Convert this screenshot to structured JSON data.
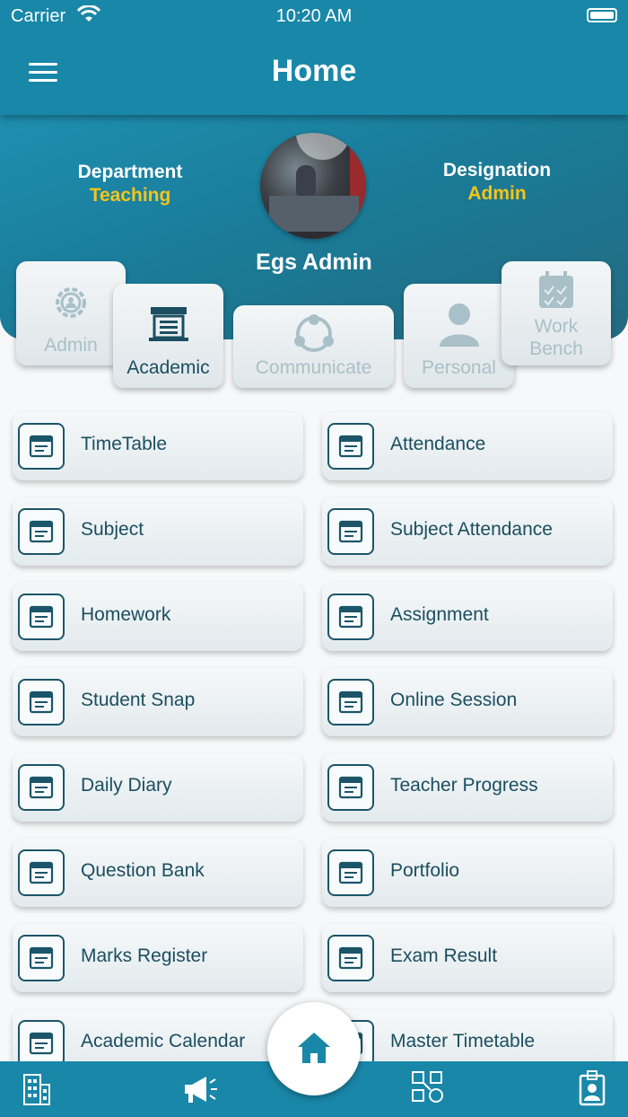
{
  "status": {
    "carrier": "Carrier",
    "time": "10:20 AM"
  },
  "header": {
    "title": "Home"
  },
  "profile": {
    "department_label": "Department",
    "department_value": "Teaching",
    "designation_label": "Designation",
    "designation_value": "Admin",
    "name": "Egs Admin"
  },
  "tabs": {
    "admin": "Admin",
    "academic": "Academic",
    "communicate": "Communicate",
    "personal": "Personal",
    "workbench_line1": "Work",
    "workbench_line2": "Bench",
    "active": "Academic"
  },
  "features": [
    {
      "label": "TimeTable",
      "icon": "timetable-icon"
    },
    {
      "label": "Attendance",
      "icon": "attendance-icon"
    },
    {
      "label": "Subject",
      "icon": "subject-icon"
    },
    {
      "label": "Subject Attendance",
      "icon": "subject-attendance-icon"
    },
    {
      "label": "Homework",
      "icon": "homework-icon"
    },
    {
      "label": "Assignment",
      "icon": "assignment-icon"
    },
    {
      "label": "Student Snap",
      "icon": "student-snap-icon"
    },
    {
      "label": "Online Session",
      "icon": "online-session-icon"
    },
    {
      "label": "Daily Diary",
      "icon": "daily-diary-icon"
    },
    {
      "label": "Teacher Progress",
      "icon": "teacher-progress-icon"
    },
    {
      "label": "Question Bank",
      "icon": "question-bank-icon"
    },
    {
      "label": "Portfolio",
      "icon": "portfolio-icon"
    },
    {
      "label": "Marks Register",
      "icon": "marks-register-icon"
    },
    {
      "label": "Exam Result",
      "icon": "exam-result-icon"
    },
    {
      "label": "Academic Calendar",
      "icon": "academic-calendar-icon"
    },
    {
      "label": "Master Timetable",
      "icon": "master-timetable-icon"
    }
  ],
  "bottom_nav": [
    "building-icon",
    "megaphone-icon",
    "home-icon",
    "apps-icon",
    "id-badge-icon"
  ],
  "colors": {
    "primary": "#1987a8",
    "accent": "#f5c518",
    "text_dark": "#1b4e60",
    "inactive": "#a9c0c9"
  }
}
